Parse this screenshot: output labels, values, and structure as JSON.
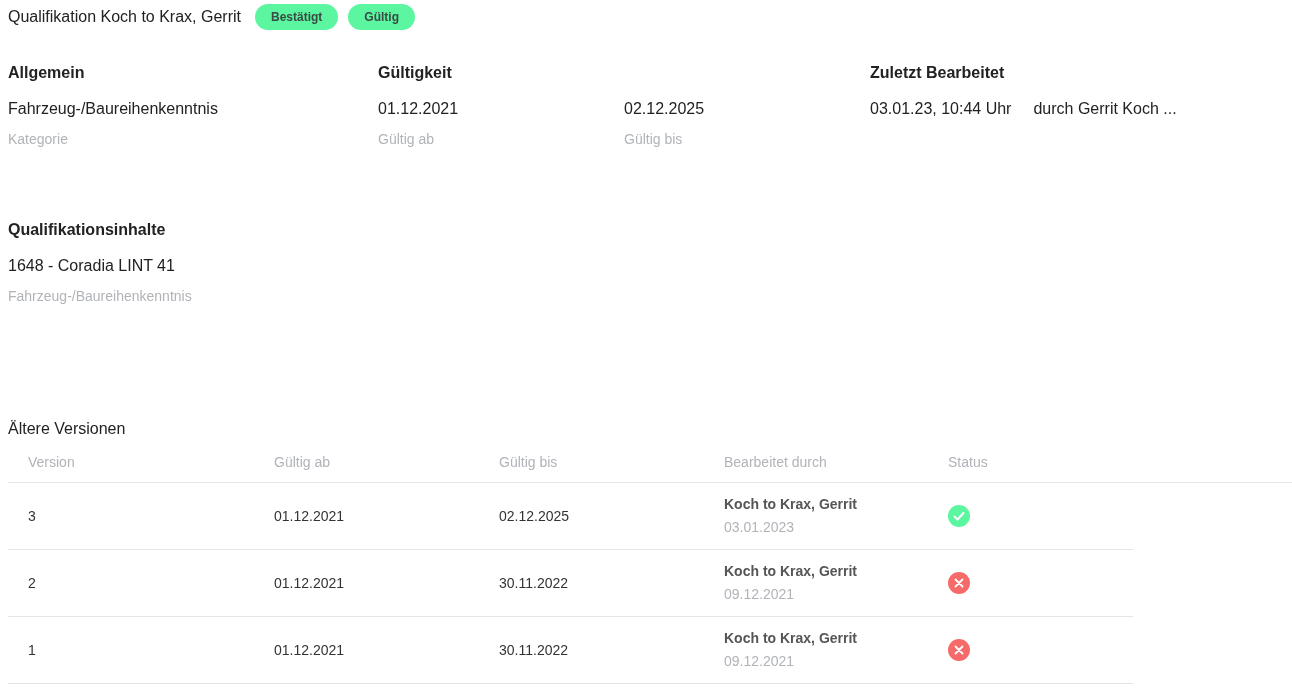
{
  "header": {
    "title": "Qualifikation Koch to Krax, Gerrit",
    "badges": [
      "Bestätigt",
      "Gültig"
    ]
  },
  "allgemein": {
    "heading": "Allgemein",
    "value": "Fahrzeug-/Baureihenkenntnis",
    "label": "Kategorie"
  },
  "gueltigkeit": {
    "heading": "Gültigkeit",
    "fields": [
      {
        "value": "01.12.2021",
        "label": "Gültig ab"
      },
      {
        "value": "02.12.2025",
        "label": "Gültig bis"
      }
    ]
  },
  "zuletzt": {
    "heading": "Zuletzt Bearbeitet",
    "time": "03.01.23, 10:44 Uhr",
    "by": "durch Gerrit Koch ..."
  },
  "inhalte": {
    "heading": "Qualifikationsinhalte",
    "value": "1648 - Coradia LINT 41",
    "label": "Fahrzeug-/Baureihenkenntnis"
  },
  "versions": {
    "title": "Ältere Versionen",
    "columns": [
      "Version",
      "Gültig ab",
      "Gültig bis",
      "Bearbeitet durch",
      "Status"
    ],
    "rows": [
      {
        "version": "3",
        "from": "01.12.2021",
        "to": "02.12.2025",
        "editor": "Koch to Krax, Gerrit",
        "date": "03.01.2023",
        "kind": "valid"
      },
      {
        "version": "2",
        "from": "01.12.2021",
        "to": "30.11.2022",
        "editor": "Koch to Krax, Gerrit",
        "date": "09.12.2021",
        "kind": "invalid"
      },
      {
        "version": "1",
        "from": "01.12.2021",
        "to": "30.11.2022",
        "editor": "Koch to Krax, Gerrit",
        "date": "09.12.2021",
        "kind": "invalid"
      }
    ]
  }
}
